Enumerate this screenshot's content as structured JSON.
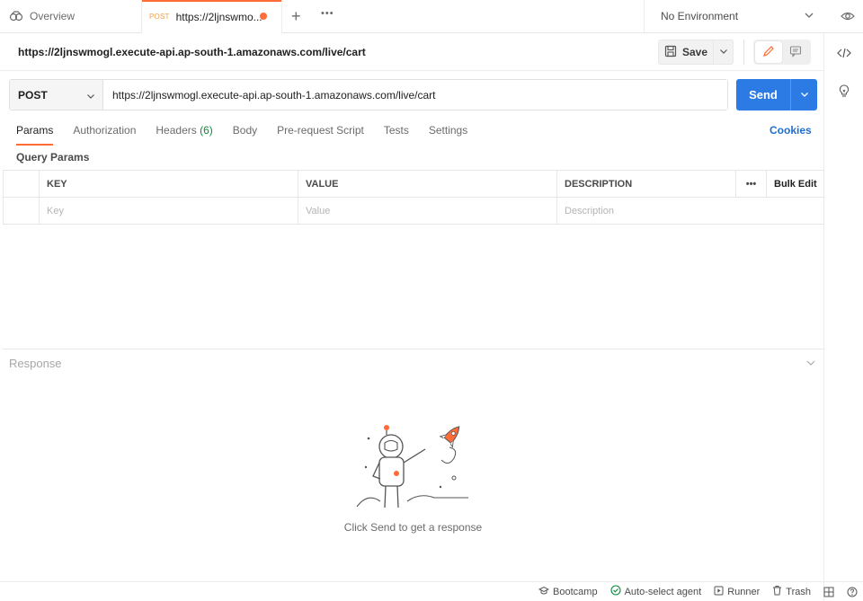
{
  "tabs": {
    "overview_label": "Overview",
    "request": {
      "method": "POST",
      "title": "https://2ljnswmo..."
    },
    "unsaved_dot_color": "#ff6c37"
  },
  "environment": {
    "label": "No Environment"
  },
  "request": {
    "title": "https://2ljnswmogl.execute-api.ap-south-1.amazonaws.com/live/cart",
    "method": "POST",
    "url": "https://2ljnswmogl.execute-api.ap-south-1.amazonaws.com/live/cart",
    "save_label": "Save",
    "send_label": "Send"
  },
  "request_tabs": [
    {
      "label": "Params",
      "active": true
    },
    {
      "label": "Authorization"
    },
    {
      "label": "Headers",
      "count": "(6)"
    },
    {
      "label": "Body"
    },
    {
      "label": "Pre-request Script"
    },
    {
      "label": "Tests"
    },
    {
      "label": "Settings"
    }
  ],
  "cookies_label": "Cookies",
  "query_params": {
    "title": "Query Params",
    "headers": {
      "key": "KEY",
      "value": "VALUE",
      "description": "DESCRIPTION",
      "more": "•••",
      "bulk_edit": "Bulk Edit"
    },
    "placeholders": {
      "key": "Key",
      "value": "Value",
      "description": "Description"
    }
  },
  "response": {
    "title": "Response",
    "empty_message": "Click Send to get a response"
  },
  "statusbar": {
    "bootcamp": "Bootcamp",
    "agent": "Auto-select agent",
    "runner": "Runner",
    "trash": "Trash"
  },
  "colors": {
    "accent": "#ff6c37",
    "send": "#2c7be5",
    "link": "#1f6fd1",
    "count": "#0b8a3c"
  },
  "icons": [
    "overview-icon",
    "plus-icon",
    "more-icon",
    "chevron-down-icon",
    "eye-icon",
    "save-icon",
    "pencil-icon",
    "comment-icon",
    "code-icon",
    "bulb-icon",
    "graduation-cap-icon",
    "check-circle-icon",
    "play-icon",
    "trash-icon",
    "layout-icon",
    "help-icon"
  ]
}
